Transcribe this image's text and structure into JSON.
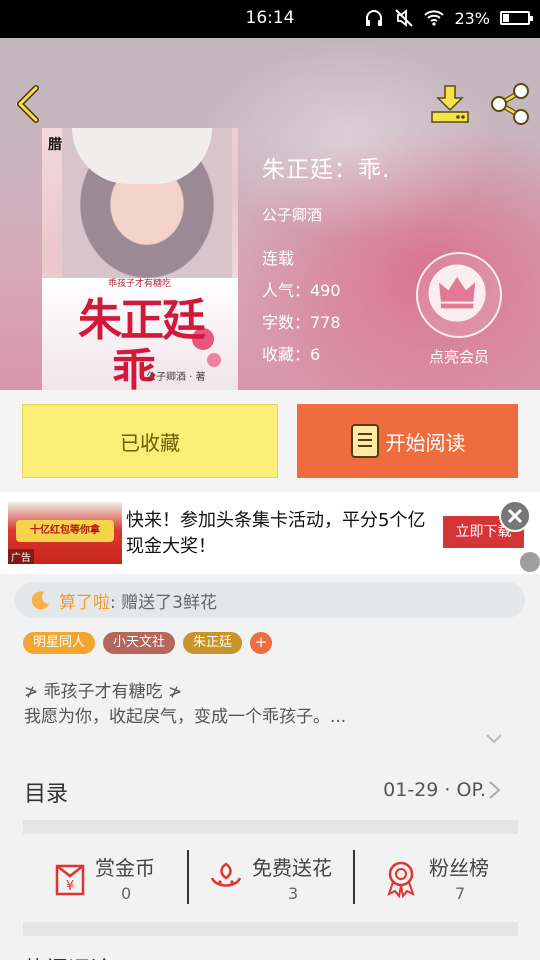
{
  "status_bar": {
    "time": "16:14",
    "battery": "23%",
    "battery_level": 0.23
  },
  "book": {
    "title": "朱正廷：乖.",
    "author": "公子卿酒",
    "status": "连载",
    "popularity": "人气：490",
    "word_count": "字数：778",
    "favorites": "收藏：6"
  },
  "cover": {
    "badge": "腊",
    "subtitle": "乖孩子才有糖吃",
    "title_line1": "朱正廷",
    "title_line2": "乖",
    "author": "公子卿酒 · 著"
  },
  "vip": {
    "label": "点亮会员"
  },
  "actions": {
    "favorite_label": "已收藏",
    "read_label": "开始阅读"
  },
  "ad": {
    "banner_text": "十亿红包等你拿",
    "ad_mark": "广告",
    "text": "快来！参加头条集卡活动，平分5个亿现金大奖！",
    "cta": "立即下载"
  },
  "flower": {
    "user": "算了啦",
    "message": ": 赠送了3鲜花"
  },
  "tags": [
    {
      "label": "明星同人",
      "color": "#f2a531"
    },
    {
      "label": "小天文社",
      "color": "#b4675a"
    },
    {
      "label": "朱正廷",
      "color": "#c9952b"
    }
  ],
  "tag_add": "+",
  "description": {
    "line1": "≯ 乖孩子才有糖吃 ≯",
    "line2": "我愿为你，收起戾气，变成一个乖孩子。..."
  },
  "toc": {
    "label": "目录",
    "latest": "01-29 · OP."
  },
  "stats": [
    {
      "name": "赏金币",
      "count": "0"
    },
    {
      "name": "免费送花",
      "count": "3"
    },
    {
      "name": "粉丝榜",
      "count": "7"
    }
  ],
  "next_section_peek": "热门评论"
}
